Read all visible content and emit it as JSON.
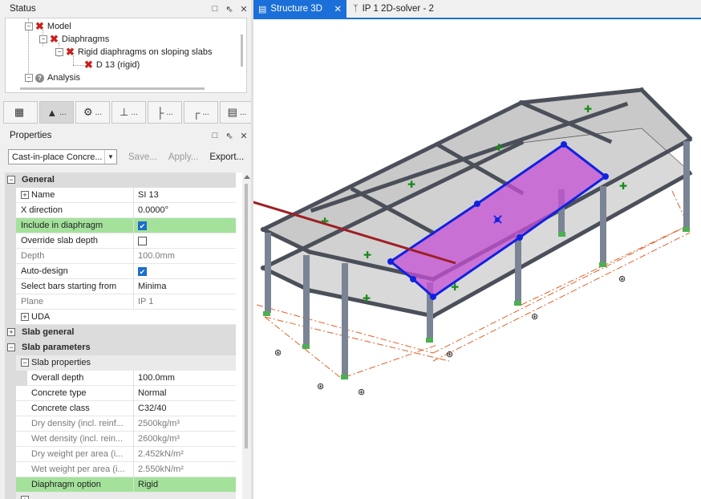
{
  "status_panel": {
    "title": "Status",
    "tree": [
      {
        "label": "Model",
        "icon": "x-icon"
      },
      {
        "label": "Diaphragms",
        "icon": "x-icon"
      },
      {
        "label": "Rigid diaphragms on sloping slabs",
        "icon": "x-icon"
      },
      {
        "label": "D 13 (rigid)",
        "icon": "x-icon"
      },
      {
        "label": "Analysis",
        "icon": "question-icon"
      }
    ]
  },
  "toolbar": {
    "buttons": [
      {
        "icon": "model-icon",
        "label": ""
      },
      {
        "icon": "load-icon",
        "label": "..."
      },
      {
        "icon": "analysis-icon",
        "label": "..."
      },
      {
        "icon": "design-icon",
        "label": "..."
      },
      {
        "icon": "frame-icon",
        "label": "..."
      },
      {
        "icon": "beam-icon",
        "label": "..."
      },
      {
        "icon": "report-icon",
        "label": "..."
      }
    ]
  },
  "properties_panel": {
    "title": "Properties",
    "type_select": "Cast-in-place Concre...",
    "save_label": "Save...",
    "apply_label": "Apply...",
    "export_label": "Export..."
  },
  "grid": {
    "general": "General",
    "name_label": "Name",
    "name_value": "SI 13",
    "xdir_label": "X direction",
    "xdir_value": "0.0000°",
    "include_label": "Include in diaphragm",
    "override_label": "Override slab depth",
    "depth_label": "Depth",
    "depth_value": "100.0mm",
    "autodesign_label": "Auto-design",
    "selectbars_label": "Select bars starting from",
    "selectbars_value": "Minima",
    "plane_label": "Plane",
    "plane_value": "IP 1",
    "uda_label": "UDA",
    "slab_general": "Slab general",
    "slab_parameters": "Slab parameters",
    "slab_properties": "Slab properties",
    "overall_depth_label": "Overall depth",
    "overall_depth_value": "100.0mm",
    "concrete_type_label": "Concrete type",
    "concrete_type_value": "Normal",
    "concrete_class_label": "Concrete class",
    "concrete_class_value": "C32/40",
    "dry_density_label": "Dry density (incl. reinf...",
    "dry_density_value": "2500kg/m³",
    "wet_density_label": "Wet density (incl. rein...",
    "wet_density_value": "2600kg/m³",
    "dry_weight_label": "Dry weight per area (i...",
    "dry_weight_value": "2.452kN/m²",
    "wet_weight_label": "Wet weight per area (i...",
    "wet_weight_value": "2.550kN/m²",
    "diaphragm_option_label": "Diaphragm option",
    "diaphragm_option_value": "Rigid",
    "checkbox_include": true,
    "checkbox_override": false,
    "checkbox_autodesign": true
  },
  "tabs": [
    {
      "label": "Structure 3D",
      "active": true
    },
    {
      "label": "IP 1 2D-solver - 2",
      "active": false
    }
  ],
  "colors": {
    "accent": "#1b6fd8",
    "highlight": "#a4e29c",
    "diaphragm_fill": "#c64fd6",
    "diaphragm_outline": "#1022e0",
    "arrow": "#9e1f24",
    "column": "#7b8494",
    "gridline": "#e0622a"
  }
}
